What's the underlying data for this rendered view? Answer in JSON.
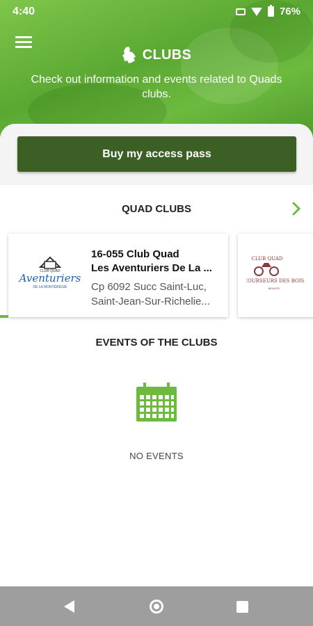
{
  "status_bar": {
    "time": "4:40",
    "battery": "76%",
    "icons": [
      "vibrate-icon",
      "wifi-icon",
      "battery-icon"
    ]
  },
  "header": {
    "menu_icon": "menu-icon",
    "title_icon": "quebec-map-icon",
    "title": "CLUBS",
    "subtitle": "Check out information and events related to Quads clubs.",
    "accent_color": "#5aa832"
  },
  "access_pass": {
    "button_label": "Buy my access pass",
    "button_color": "#3c5f25"
  },
  "clubs_section": {
    "title": "QUAD CLUBS",
    "more_icon": "chevron-right-icon",
    "clubs": [
      {
        "logo_text_top": "CLUB QUAD",
        "logo_text_main": "Aventuriers",
        "logo_text_sub": "DE LA MONTÉRÉGIE",
        "name_line1": "16-055 Club Quad",
        "name_line2": "Les Aventuriers De La ...",
        "address_line1": "Cp 6092 Succ Saint-Luc,",
        "address_line2": "Saint-Jean-Sur-Richelie..."
      },
      {
        "logo_text_top": "CLUB QUAD",
        "logo_text_main": "COURSEURS DES BOIS",
        "logo_text_sub": "BEAUCE"
      }
    ]
  },
  "events_section": {
    "title": "EVENTS OF THE CLUBS",
    "empty_icon": "calendar-icon",
    "empty_text": "NO EVENTS",
    "icon_color": "#6dba3f"
  },
  "nav_bar": {
    "icons": [
      "back-icon",
      "home-icon",
      "recent-apps-icon"
    ]
  }
}
